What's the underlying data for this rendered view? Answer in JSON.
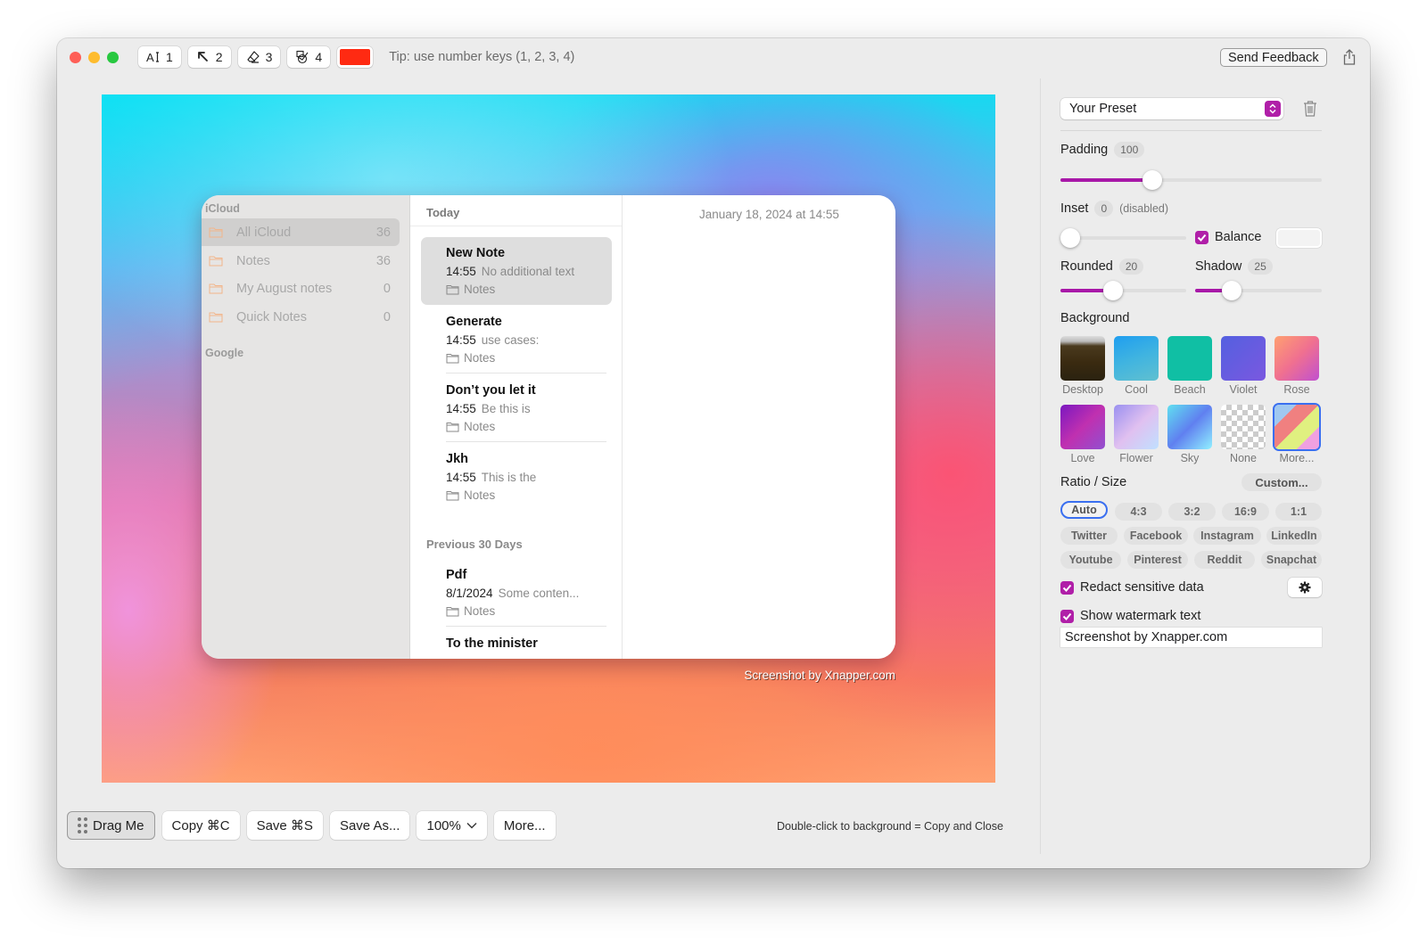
{
  "toolbar": {
    "tools": [
      {
        "icon": "text-cursor-icon",
        "key": "1"
      },
      {
        "icon": "arrow-pointer-icon",
        "key": "2"
      },
      {
        "icon": "eraser-icon",
        "key": "3"
      },
      {
        "icon": "redact-shapes-icon",
        "key": "4"
      }
    ],
    "current_color": "#ff2a12",
    "tip": "Tip: use number keys (1, 2, 3, 4)",
    "send_feedback_label": "Send Feedback"
  },
  "preview": {
    "notes_app": {
      "sidebar": {
        "sections": [
          "iCloud",
          "Google"
        ],
        "folders": [
          {
            "label": "All iCloud",
            "count": "36",
            "selected": true
          },
          {
            "label": "Notes",
            "count": "36"
          },
          {
            "label": "My August notes",
            "count": "0"
          },
          {
            "label": "Quick Notes",
            "count": "0"
          }
        ]
      },
      "list": {
        "today_header": "Today",
        "previous_header": "Previous 30 Days",
        "notes": [
          {
            "title": "New Note",
            "time": "14:55",
            "preview": "No additional text",
            "folder": "Notes"
          },
          {
            "title": "Generate",
            "time": "14:55",
            "preview": "use cases:",
            "folder": "Notes"
          },
          {
            "title": "Don’t you let it",
            "time": "14:55",
            "preview": "Be this is",
            "folder": "Notes"
          },
          {
            "title": "Jkh",
            "time": "14:55",
            "preview": "This is the",
            "folder": "Notes"
          },
          {
            "title": "Pdf",
            "time": "8/1/2024",
            "preview": "Some conten...",
            "folder": "Notes"
          },
          {
            "title": "To the minister",
            "time": "",
            "preview": "",
            "folder": ""
          }
        ]
      },
      "detail_date": "January 18, 2024 at 14:55"
    },
    "watermark": "Screenshot by Xnapper.com"
  },
  "bottom_bar": {
    "drag_label": "Drag Me",
    "copy_label": "Copy ⌘C",
    "save_label": "Save ⌘S",
    "save_as_label": "Save As...",
    "zoom_value": "100%",
    "more_label": "More...",
    "hint": "Double-click to background = Copy and Close"
  },
  "panel": {
    "preset": "Your Preset",
    "padding": {
      "label": "Padding",
      "value": "100",
      "fraction": 0.35
    },
    "inset": {
      "label": "Inset",
      "value": "0",
      "note": "(disabled)",
      "fraction": 0.0
    },
    "balance": {
      "label": "Balance",
      "checked": true
    },
    "rounded": {
      "label": "Rounded",
      "value": "20",
      "fraction": 0.42
    },
    "shadow": {
      "label": "Shadow",
      "value": "25",
      "fraction": 0.29
    },
    "background": {
      "label": "Background",
      "options": [
        {
          "name": "Desktop"
        },
        {
          "name": "Cool"
        },
        {
          "name": "Beach"
        },
        {
          "name": "Violet"
        },
        {
          "name": "Rose"
        },
        {
          "name": "Love"
        },
        {
          "name": "Flower"
        },
        {
          "name": "Sky"
        },
        {
          "name": "None"
        },
        {
          "name": "More...",
          "selected": true
        }
      ]
    },
    "ratio": {
      "label": "Ratio / Size",
      "custom_label": "Custom...",
      "options": [
        "Auto",
        "4:3",
        "3:2",
        "16:9",
        "1:1",
        "Twitter",
        "Facebook",
        "Instagram",
        "LinkedIn",
        "Youtube",
        "Pinterest",
        "Reddit",
        "Snapchat"
      ],
      "selected": "Auto"
    },
    "redact": {
      "label": "Redact sensitive data",
      "checked": true
    },
    "watermark": {
      "label": "Show watermark text",
      "checked": true,
      "value": "Screenshot by Xnapper.com"
    }
  },
  "colors": {
    "accent": "#b01fa8",
    "selection_blue": "#3a6ff0"
  }
}
